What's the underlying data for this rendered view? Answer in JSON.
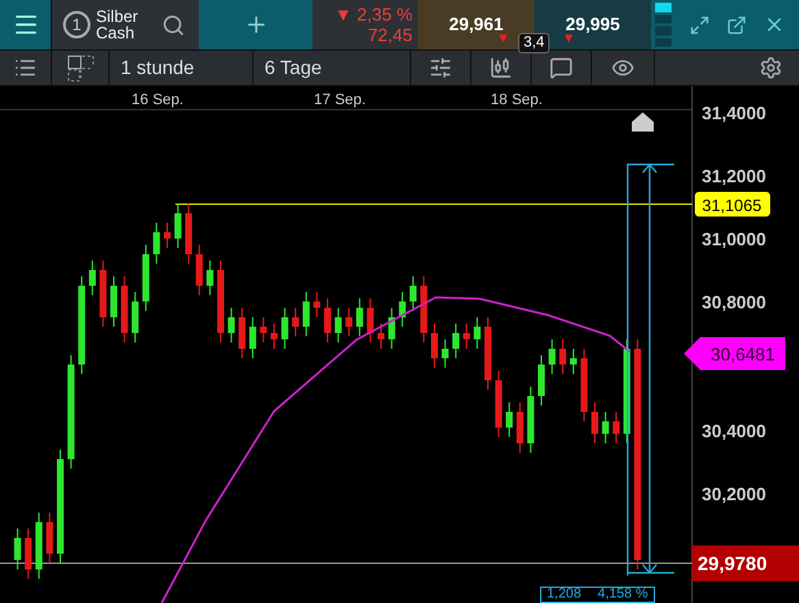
{
  "instrument": {
    "slot": "1",
    "name": "Silber Cash"
  },
  "change": {
    "percent": "▼ 2,35 %",
    "points": "72,45"
  },
  "quotes": {
    "bid": "29,961",
    "ask": "29,995",
    "spread": "3,4",
    "bid_arrow": "▼",
    "ask_arrow": "▼"
  },
  "toolbar": {
    "interval": "1 stunde",
    "range": "6 Tage"
  },
  "chart": {
    "dates": [
      "16 Sep.",
      "17 Sep.",
      "18 Sep."
    ],
    "price_ticks": [
      "31,4000",
      "31,2000",
      "31,0000",
      "30,8000",
      "30,4000",
      "30,2000"
    ],
    "markers": [
      {
        "kind": "line",
        "label": "31,1065",
        "color": "#ffff00"
      },
      {
        "kind": "average",
        "label": "30,6481",
        "color": "#ff00ff"
      },
      {
        "kind": "last",
        "label": "29,9780",
        "color": "#b30000"
      }
    ],
    "measure": {
      "points": "1,208",
      "percent": "4,158 %"
    }
  }
}
